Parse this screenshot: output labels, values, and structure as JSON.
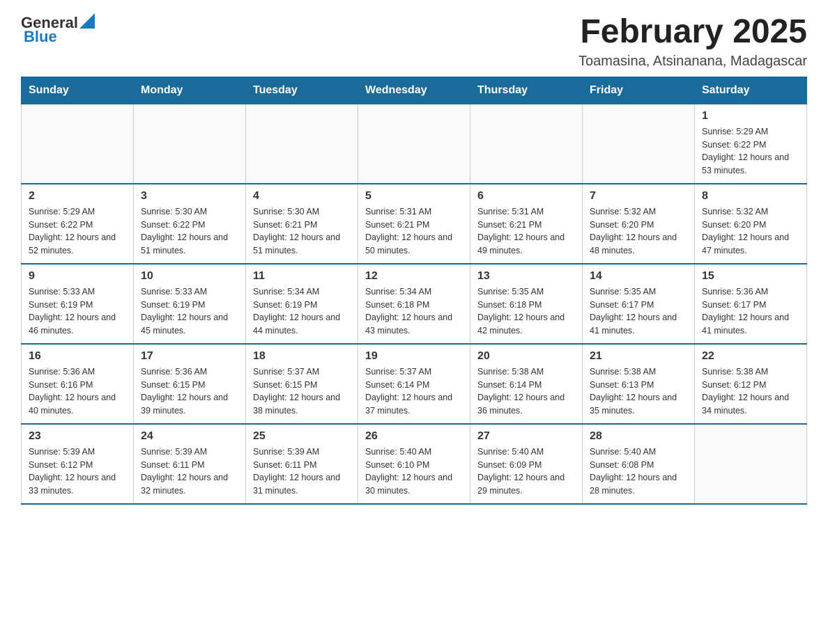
{
  "header": {
    "logo_general": "General",
    "logo_blue": "Blue",
    "title": "February 2025",
    "subtitle": "Toamasina, Atsinanana, Madagascar"
  },
  "calendar": {
    "days_of_week": [
      "Sunday",
      "Monday",
      "Tuesday",
      "Wednesday",
      "Thursday",
      "Friday",
      "Saturday"
    ],
    "weeks": [
      [
        {
          "day": "",
          "info": ""
        },
        {
          "day": "",
          "info": ""
        },
        {
          "day": "",
          "info": ""
        },
        {
          "day": "",
          "info": ""
        },
        {
          "day": "",
          "info": ""
        },
        {
          "day": "",
          "info": ""
        },
        {
          "day": "1",
          "info": "Sunrise: 5:29 AM\nSunset: 6:22 PM\nDaylight: 12 hours and 53 minutes."
        }
      ],
      [
        {
          "day": "2",
          "info": "Sunrise: 5:29 AM\nSunset: 6:22 PM\nDaylight: 12 hours and 52 minutes."
        },
        {
          "day": "3",
          "info": "Sunrise: 5:30 AM\nSunset: 6:22 PM\nDaylight: 12 hours and 51 minutes."
        },
        {
          "day": "4",
          "info": "Sunrise: 5:30 AM\nSunset: 6:21 PM\nDaylight: 12 hours and 51 minutes."
        },
        {
          "day": "5",
          "info": "Sunrise: 5:31 AM\nSunset: 6:21 PM\nDaylight: 12 hours and 50 minutes."
        },
        {
          "day": "6",
          "info": "Sunrise: 5:31 AM\nSunset: 6:21 PM\nDaylight: 12 hours and 49 minutes."
        },
        {
          "day": "7",
          "info": "Sunrise: 5:32 AM\nSunset: 6:20 PM\nDaylight: 12 hours and 48 minutes."
        },
        {
          "day": "8",
          "info": "Sunrise: 5:32 AM\nSunset: 6:20 PM\nDaylight: 12 hours and 47 minutes."
        }
      ],
      [
        {
          "day": "9",
          "info": "Sunrise: 5:33 AM\nSunset: 6:19 PM\nDaylight: 12 hours and 46 minutes."
        },
        {
          "day": "10",
          "info": "Sunrise: 5:33 AM\nSunset: 6:19 PM\nDaylight: 12 hours and 45 minutes."
        },
        {
          "day": "11",
          "info": "Sunrise: 5:34 AM\nSunset: 6:19 PM\nDaylight: 12 hours and 44 minutes."
        },
        {
          "day": "12",
          "info": "Sunrise: 5:34 AM\nSunset: 6:18 PM\nDaylight: 12 hours and 43 minutes."
        },
        {
          "day": "13",
          "info": "Sunrise: 5:35 AM\nSunset: 6:18 PM\nDaylight: 12 hours and 42 minutes."
        },
        {
          "day": "14",
          "info": "Sunrise: 5:35 AM\nSunset: 6:17 PM\nDaylight: 12 hours and 41 minutes."
        },
        {
          "day": "15",
          "info": "Sunrise: 5:36 AM\nSunset: 6:17 PM\nDaylight: 12 hours and 41 minutes."
        }
      ],
      [
        {
          "day": "16",
          "info": "Sunrise: 5:36 AM\nSunset: 6:16 PM\nDaylight: 12 hours and 40 minutes."
        },
        {
          "day": "17",
          "info": "Sunrise: 5:36 AM\nSunset: 6:15 PM\nDaylight: 12 hours and 39 minutes."
        },
        {
          "day": "18",
          "info": "Sunrise: 5:37 AM\nSunset: 6:15 PM\nDaylight: 12 hours and 38 minutes."
        },
        {
          "day": "19",
          "info": "Sunrise: 5:37 AM\nSunset: 6:14 PM\nDaylight: 12 hours and 37 minutes."
        },
        {
          "day": "20",
          "info": "Sunrise: 5:38 AM\nSunset: 6:14 PM\nDaylight: 12 hours and 36 minutes."
        },
        {
          "day": "21",
          "info": "Sunrise: 5:38 AM\nSunset: 6:13 PM\nDaylight: 12 hours and 35 minutes."
        },
        {
          "day": "22",
          "info": "Sunrise: 5:38 AM\nSunset: 6:12 PM\nDaylight: 12 hours and 34 minutes."
        }
      ],
      [
        {
          "day": "23",
          "info": "Sunrise: 5:39 AM\nSunset: 6:12 PM\nDaylight: 12 hours and 33 minutes."
        },
        {
          "day": "24",
          "info": "Sunrise: 5:39 AM\nSunset: 6:11 PM\nDaylight: 12 hours and 32 minutes."
        },
        {
          "day": "25",
          "info": "Sunrise: 5:39 AM\nSunset: 6:11 PM\nDaylight: 12 hours and 31 minutes."
        },
        {
          "day": "26",
          "info": "Sunrise: 5:40 AM\nSunset: 6:10 PM\nDaylight: 12 hours and 30 minutes."
        },
        {
          "day": "27",
          "info": "Sunrise: 5:40 AM\nSunset: 6:09 PM\nDaylight: 12 hours and 29 minutes."
        },
        {
          "day": "28",
          "info": "Sunrise: 5:40 AM\nSunset: 6:08 PM\nDaylight: 12 hours and 28 minutes."
        },
        {
          "day": "",
          "info": ""
        }
      ]
    ]
  }
}
